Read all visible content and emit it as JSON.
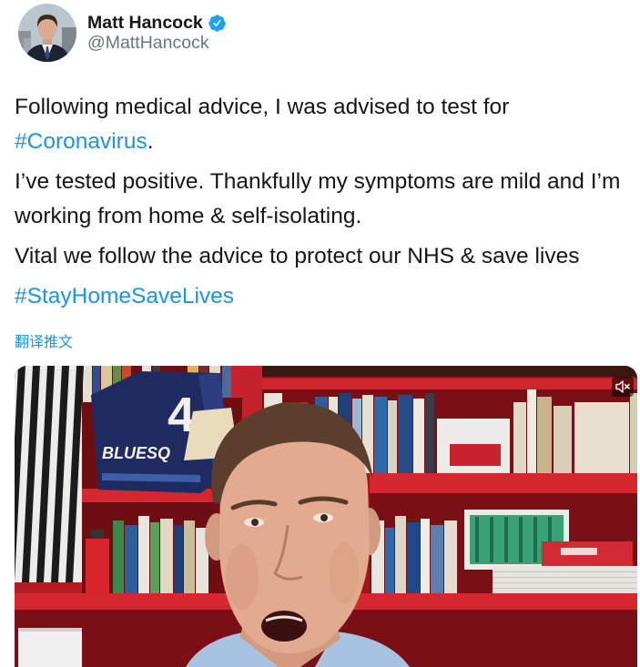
{
  "author": {
    "name": "Matt Hancock",
    "handle": "@MattHancock",
    "verified": true,
    "verified_icon": "verified-badge-icon"
  },
  "tweet": {
    "p1_text": "Following medical advice, I was advised to test for ",
    "p1_hashtag": "#Coronavirus",
    "p1_end": ".",
    "p2": "I’ve tested positive. Thankfully my symptoms are mild and I’m working from home & self-isolating.",
    "p3": "Vital we follow the advice to protect our NHS & save lives",
    "p4_hashtag": "#StayHomeSaveLives"
  },
  "translate_label": "翻译推文",
  "video": {
    "muted": true,
    "mute_icon": "speaker-muted-icon",
    "jersey_number": "4",
    "jersey_text": "BLUESQ"
  },
  "colors": {
    "text": "#14171a",
    "link": "#1b95e0",
    "secondary": "#657786",
    "verified": "#1da1f2",
    "shelf_red": "#a3161c"
  }
}
